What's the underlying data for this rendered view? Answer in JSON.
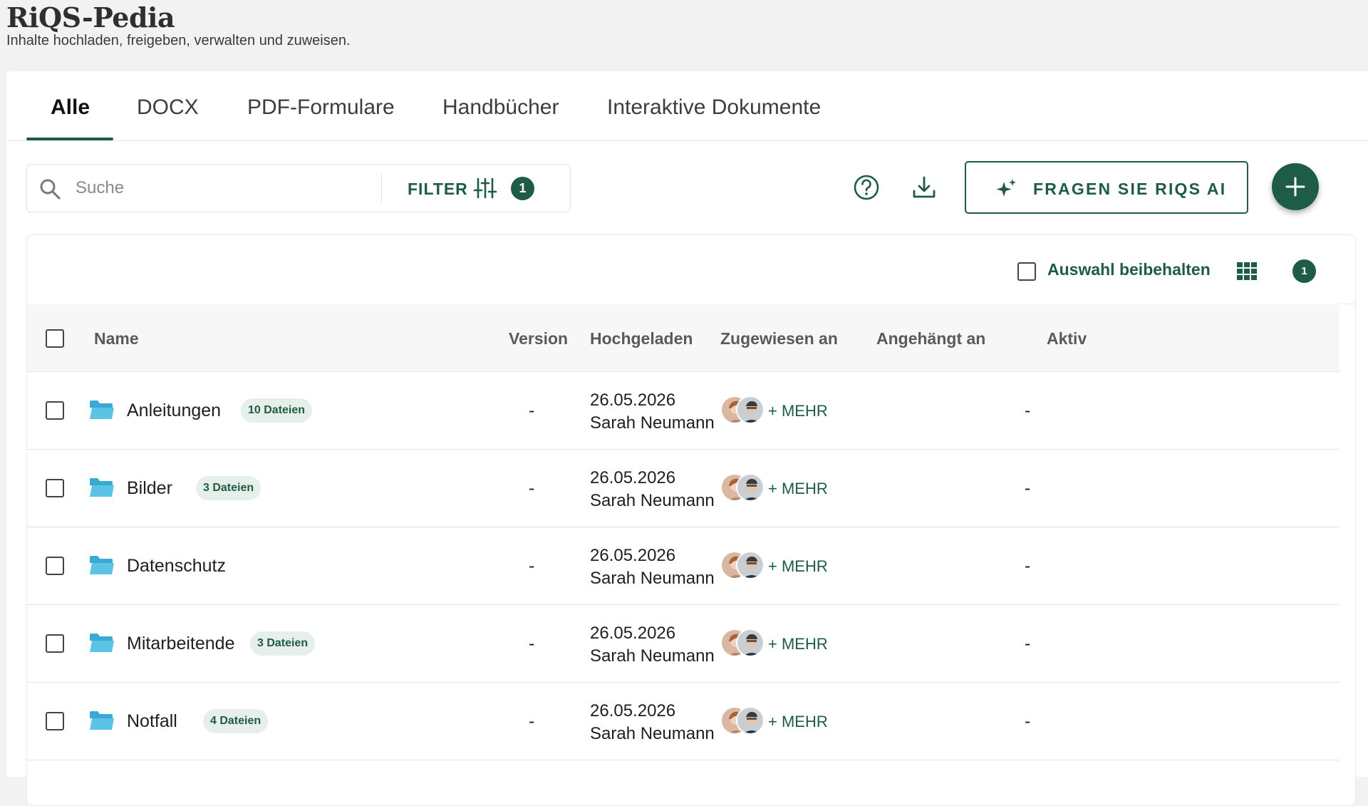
{
  "app": {
    "title": "RiQS-Pedia",
    "subtitle": "Inhalte hochladen, freigeben, verwalten und zuweisen."
  },
  "tabs": [
    {
      "label": "Alle",
      "active": true
    },
    {
      "label": "DOCX",
      "active": false
    },
    {
      "label": "PDF-Formulare",
      "active": false
    },
    {
      "label": "Handbücher",
      "active": false
    },
    {
      "label": "Interaktive Dokumente",
      "active": false
    }
  ],
  "search": {
    "placeholder": "Suche",
    "value": ""
  },
  "filter": {
    "label": "FILTER",
    "count": "1"
  },
  "actions": {
    "help_icon": "help-circle-icon",
    "download_icon": "download-icon",
    "ai_label": "FRAGEN SIE RIQS AI",
    "ai_icon": "sparkle-icon",
    "add_icon": "plus-icon"
  },
  "toolbar": {
    "keep_selection_label": "Auswahl beibehalten",
    "selection_count": "1"
  },
  "table": {
    "columns": {
      "name": "Name",
      "version": "Version",
      "uploaded": "Hochgeladen",
      "assigned": "Zugewiesen an",
      "attached": "Angehängt an",
      "active": "Aktiv"
    },
    "rows": [
      {
        "name": "Anleitungen",
        "badge": "10 Dateien",
        "version": "-",
        "date": "26.05.2026",
        "uploader": "Sarah Neumann",
        "more": "+ MEHR",
        "attached": "",
        "active": "-"
      },
      {
        "name": "Bilder",
        "badge": "3 Dateien",
        "version": "-",
        "date": "26.05.2026",
        "uploader": "Sarah Neumann",
        "more": "+ MEHR",
        "attached": "",
        "active": "-"
      },
      {
        "name": "Datenschutz",
        "badge": "",
        "version": "-",
        "date": "26.05.2026",
        "uploader": "Sarah Neumann",
        "more": "+ MEHR",
        "attached": "",
        "active": "-"
      },
      {
        "name": "Mitarbeitende",
        "badge": "3 Dateien",
        "version": "-",
        "date": "26.05.2026",
        "uploader": "Sarah Neumann",
        "more": "+ MEHR",
        "attached": "",
        "active": "-"
      },
      {
        "name": "Notfall",
        "badge": "4 Dateien",
        "version": "-",
        "date": "26.05.2026",
        "uploader": "Sarah Neumann",
        "more": "+ MEHR",
        "attached": "",
        "active": "-"
      }
    ]
  },
  "colors": {
    "accent": "#1e5c47",
    "folder": "#5bc3e6",
    "badge_bg": "#e6efe9"
  }
}
